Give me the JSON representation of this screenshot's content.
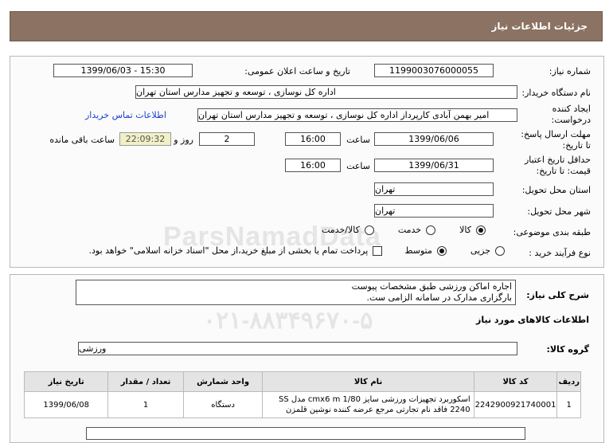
{
  "header": {
    "title": "جزئیات اطلاعات نیاز"
  },
  "fields": {
    "need_number_label": "شماره نیاز:",
    "need_number": "1199003076000055",
    "announce_label": "تاریخ و ساعت اعلان عمومی:",
    "announce_value": "1399/06/03 - 15:30",
    "buyer_label": "نام دستگاه خریدار:",
    "buyer_value": "اداره کل نوسازی ، توسعه و تجهیز مدارس استان تهران",
    "creator_label_1": "ایجاد کننده",
    "creator_label_2": "درخواست:",
    "creator_value": "امیر بهمن آبادی کارپرداز اداره کل نوسازی ، توسعه و تجهیز مدارس استان تهران",
    "contact_link": "اطلاعات تماس خریدار",
    "reply_label_1": "مهلت ارسال پاسخ:",
    "reply_label_2": "تا تاریخ:",
    "reply_date": "1399/06/06",
    "time_label": "ساعت",
    "reply_time": "16:00",
    "days_value": "2",
    "days_label": "روز و",
    "timer_value": "22:09:32",
    "remaining_label": "ساعت باقی مانده",
    "validity_label_1": "حداقل تاریخ اعتبار",
    "validity_label_2": "قیمت: تا تاریخ:",
    "validity_date": "1399/06/31",
    "validity_time": "16:00",
    "province_label": "استان محل تحویل:",
    "province_value": "تهران",
    "city_label": "شهر محل تحویل:",
    "city_value": "تهران",
    "category_label": "طبقه بندی موضوعی:",
    "category_options": [
      "کالا",
      "خدمت",
      "کالا/خدمت"
    ],
    "process_label": "نوع فرآیند خرید :",
    "process_options": [
      "جزیی",
      "متوسط"
    ],
    "payment_note": "پرداخت تمام یا بخشی از مبلغ خرید،از محل \"اسناد خزانه اسلامی\" خواهد بود."
  },
  "description": {
    "label": "شرح کلی نیاز:",
    "line1": "اجاره اماکن ورزشی طبق مشخصات پیوست",
    "line2": "بارگزاری مدارک در سامانه الزامی ست."
  },
  "goods": {
    "section_title": "اطلاعات کالاهای مورد نیاز",
    "group_label": "گروه کالا:",
    "group_value": "ورزشی",
    "columns": [
      "ردیف",
      "کد کالا",
      "نام کالا",
      "واحد شمارش",
      "تعداد / مقدار",
      "تاریخ نیاز"
    ],
    "rows": [
      {
        "row": "1",
        "code": "2242900921740001",
        "name_line1": "اسکوربرد تجهیزات ورزشی سایز cmx6 m 1/80 مدل SS",
        "name_line2": "2240 فاقد نام تجارتی مرجع عرضه کننده نوشین قلمزن",
        "unit": "دستگاه",
        "qty": "1",
        "date": "1399/06/08"
      }
    ]
  },
  "watermark": {
    "text": "ParsNamadData"
  }
}
